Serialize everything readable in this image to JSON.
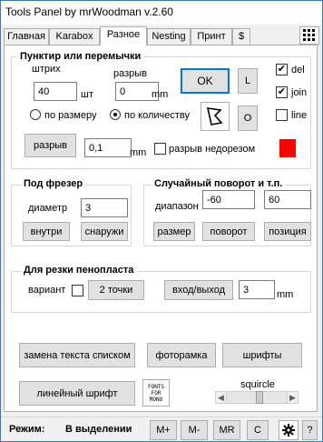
{
  "window": {
    "title": "Tools Panel by mrWoodman v.2.60"
  },
  "tabs": [
    "Главная",
    "Karabox",
    "Разное",
    "Nesting",
    "Принт",
    "$"
  ],
  "punktir": {
    "title": "Пунктир или перемычки",
    "shtrih_label": "штрих",
    "shtrih_value": "40",
    "shtrih_unit": "шт",
    "razryv_label": "разрыв",
    "razryv_value": "0",
    "razryv_unit": "mm",
    "ok": "OK",
    "L": "L",
    "O": "O",
    "del": "del",
    "join": "join",
    "line": "line",
    "radio_size": "по размеру",
    "radio_count": "по количеству",
    "razryv_button": "разрыв",
    "value": "0,1",
    "value_unit": "mm",
    "nedorez_label": "разрыв недорезом"
  },
  "freza": {
    "title": "Под фрезер",
    "diam_label": "диаметр",
    "diam_value": "3",
    "inside": "внутри",
    "outside": "снаружи"
  },
  "random": {
    "title": "Случайный поворот и т.п.",
    "range_label": "диапазон",
    "min": "-60",
    "max": "60",
    "size": "размер",
    "rotate": "поворот",
    "position": "позиция"
  },
  "foam": {
    "title": "Для резки пенопласта",
    "variant_label": "вариант",
    "two_points": "2 точки",
    "in_out": "вход/выход",
    "value": "3",
    "unit": "mm"
  },
  "bottom": {
    "replace_text": "замена текста списком",
    "photoframe": "фоторамка",
    "fonts": "шрифты",
    "linear_font": "линейный шрифт",
    "fonts_logo": "FONTS FOR MONO",
    "squircle": "squircle"
  },
  "status": {
    "mode_label": "Режим:",
    "mode_value": "В выделении",
    "m_plus": "M+",
    "m_minus": "M-",
    "mr": "MR",
    "c": "C",
    "help": "?"
  },
  "colors": {
    "red_swatch": "#ff0000",
    "accent": "#0078d7"
  }
}
